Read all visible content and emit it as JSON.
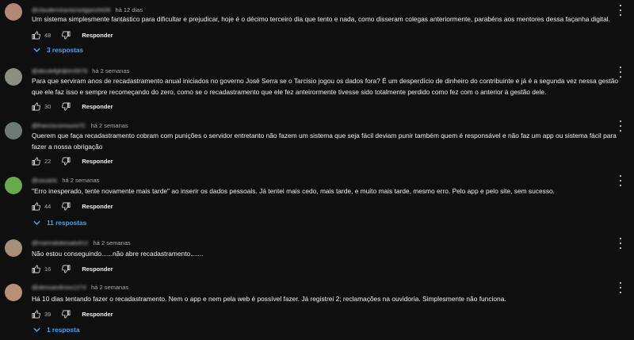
{
  "ui": {
    "reply_label": "Responder"
  },
  "comments": [
    {
      "handle": "@claudemirantoniolgpes9439",
      "time": "há 12 dias",
      "text": "Um sistema simplesmente fantástico para dificultar e prejudicar, hoje é o décimo terceiro dia que tento e nada, como disseram colegas anteriormente, parabéns aos mentores dessa façanha digital.",
      "likes": "48",
      "replies": "3 respostas",
      "avatar_color": "#b3867a"
    },
    {
      "handle": "@abcdefghijklm5678",
      "time": "há 2 semanas",
      "text": "Para que serviram anos de recadastramento anual iniciados no governo José Serra se o Tarcisio jogou os dados fora? É um desperdício de dinheiro do contribuinte e já é a segunda vez nessa gestão que ele faz isso e sempre recomeçando do zero, como se o recadastramento que ele fez anteirormente tivesse sido totalmente perdido como fez com o anterior à gestão dele.",
      "likes": "30",
      "replies": "",
      "avatar_color": "#8a8f86"
    },
    {
      "handle": "@franciscomoura7C",
      "time": "há 2 semanas",
      "text": "Querem que faça recadastramento cobram com punições o servidor entretanto não fazem um sistema que seja fácil deviam punir também quem é responsável e não faz um app ou sistema fácil para fazer a nossa obrigação",
      "likes": "22",
      "replies": "",
      "avatar_color": "#6f7a77"
    },
    {
      "handle": "@usuario",
      "time": "há 2 semanas",
      "text": "\"Erro inesperado, tente novamente mais tarde\" ao inserir os dados pessoais. Já tentei mais cedo, mais tarde, e muito mais tarde, mesmo erro. Pelo app e pelo site, sem sucesso.",
      "likes": "44",
      "replies": "11 respostas",
      "avatar_color": "#6aa84f"
    },
    {
      "handle": "@marinalobosato912",
      "time": "há 2 semanas",
      "text": "Não estou conseguindo......não abre recadastramento.......",
      "likes": "16",
      "replies": "",
      "avatar_color": "#a58e7a"
    },
    {
      "handle": "@alessandroso1274",
      "time": "há 2 semanas",
      "text": "Há 10 dias tentando fazer o recadastramento. Nem o app e nem pela web é possível fazer. Já registrei 2; reclamações na ouvidoria. Simplesmente não funciona.",
      "likes": "39",
      "replies": "1 resposta",
      "avatar_color": "#b88f77"
    }
  ]
}
